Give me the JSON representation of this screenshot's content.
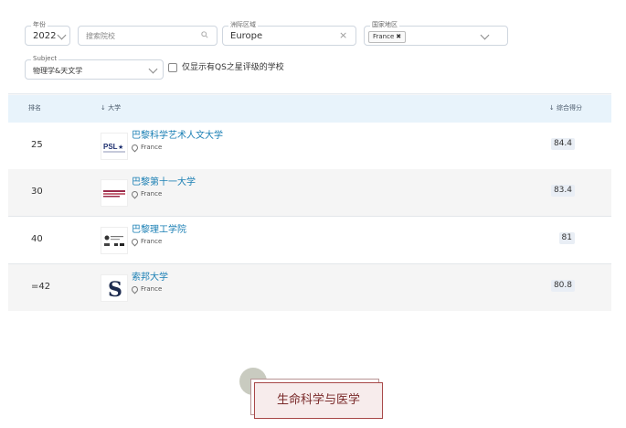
{
  "filters": {
    "year": {
      "legend": "年份",
      "value": "2022"
    },
    "search": {
      "placeholder": "搜索院校"
    },
    "region": {
      "legend": "洲际区域",
      "value": "Europe"
    },
    "country": {
      "legend": "国家地区",
      "chip": "France"
    },
    "subject": {
      "legend": "Subject",
      "value": "物理学&天文学"
    },
    "qs_stars_label": "仅显示有QS之星评级的学校"
  },
  "table": {
    "headers": {
      "rank": "排名",
      "university": "↓ 大学",
      "score": "↓  综合得分"
    },
    "rows": [
      {
        "rank": "25",
        "name": "巴黎科学艺术人文大学",
        "country": "France",
        "score": "84.4",
        "logo": "psl-logo"
      },
      {
        "rank": "30",
        "name": "巴黎第十一大学",
        "country": "France",
        "score": "83.4",
        "logo": "paris-sud-logo"
      },
      {
        "rank": "40",
        "name": "巴黎理工学院",
        "country": "France",
        "score": "81",
        "logo": "polytechnique-logo"
      },
      {
        "rank": "=42",
        "name": "索邦大学",
        "country": "France",
        "score": "80.8",
        "logo": "sorbonne-logo"
      }
    ]
  },
  "category_card": {
    "label": "生命科学与医学"
  },
  "colors": {
    "link": "#1a7fb4",
    "header_bg": "#e8f3fb",
    "card_border": "#a84848",
    "card_bg": "#f7ecec"
  }
}
